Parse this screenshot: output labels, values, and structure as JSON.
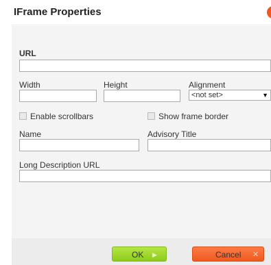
{
  "dialog": {
    "title": "IFrame Properties",
    "close_icon": "close-icon"
  },
  "form": {
    "url_label": "URL",
    "url_value": "",
    "width_label": "Width",
    "width_value": "",
    "height_label": "Height",
    "height_value": "",
    "alignment_label": "Alignment",
    "alignment_selected": "<not set>",
    "scrollbars_label": "Enable scrollbars",
    "scrollbars_checked": false,
    "border_label": "Show frame border",
    "border_checked": false,
    "name_label": "Name",
    "name_value": "",
    "advisory_label": "Advisory Title",
    "advisory_value": "",
    "longdesc_label": "Long Description URL",
    "longdesc_value": ""
  },
  "footer": {
    "ok_label": "OK",
    "ok_icon": "play-icon",
    "cancel_label": "Cancel",
    "cancel_icon": "close-x-icon"
  },
  "colors": {
    "ok_button": "#9bd22a",
    "cancel_button": "#ee5a1d",
    "content_background": "#f4f4f4"
  }
}
